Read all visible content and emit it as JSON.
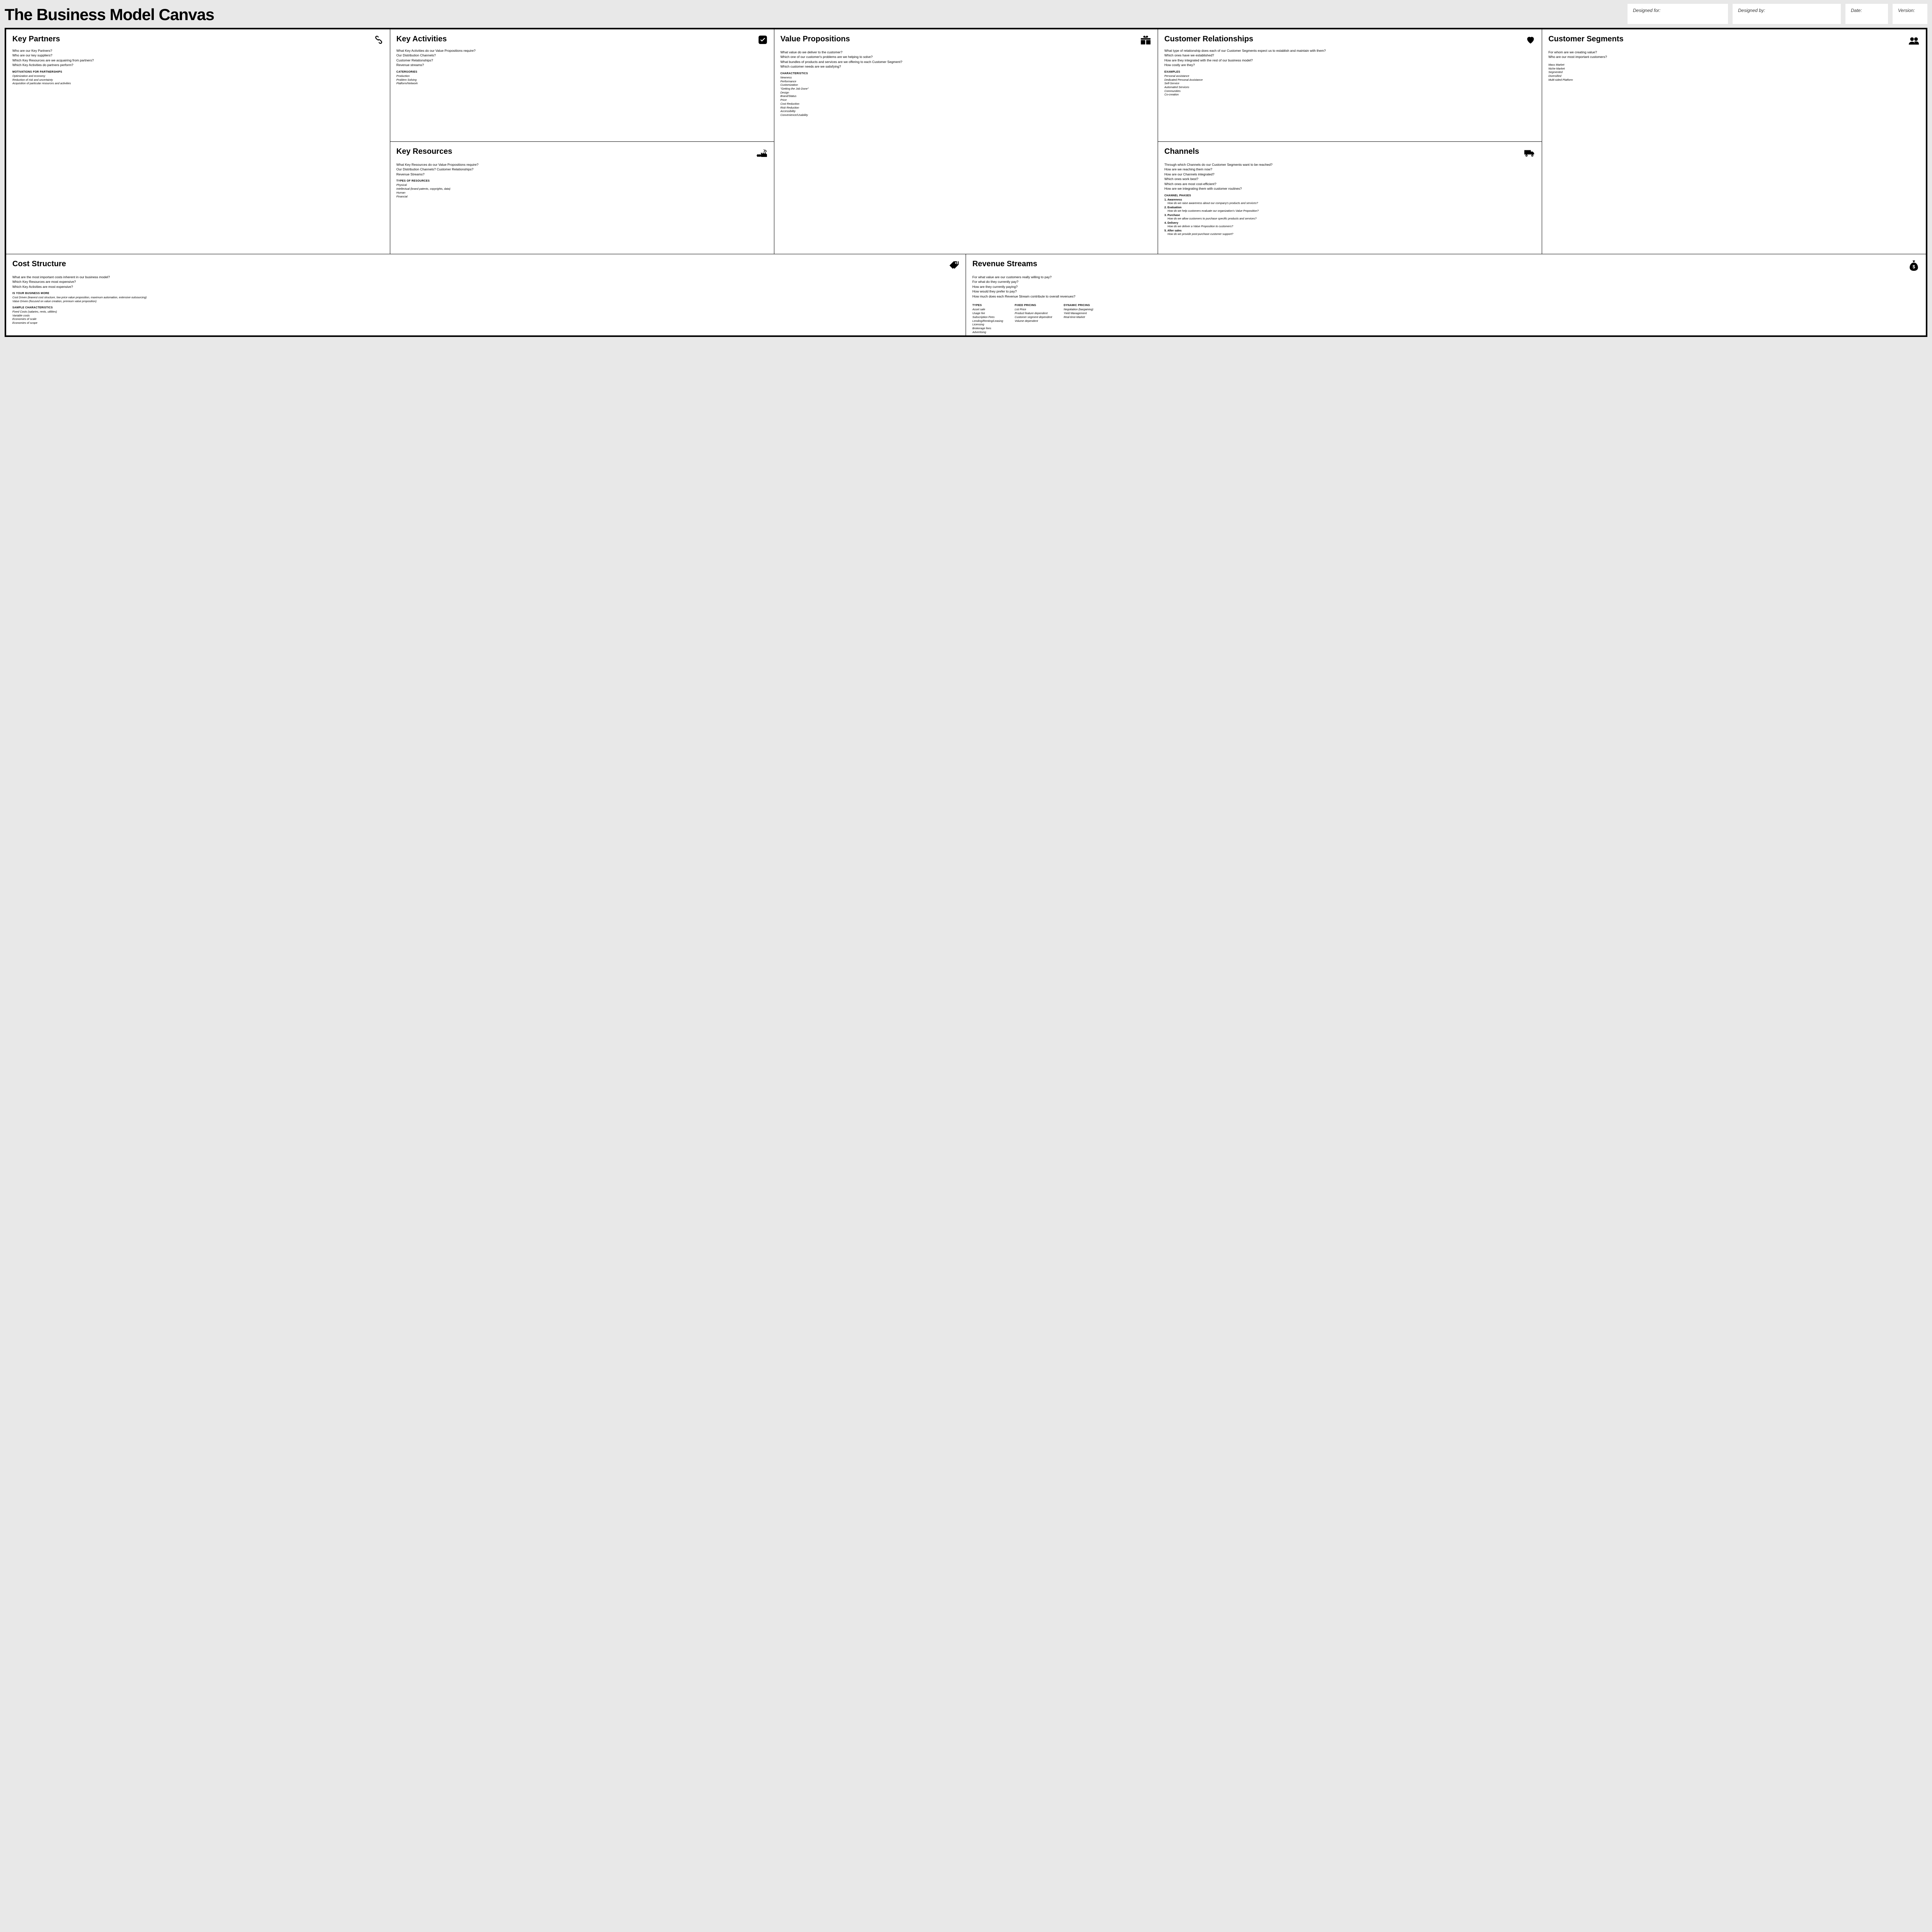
{
  "header": {
    "title": "The Business Model Canvas",
    "designed_for": "Designed for:",
    "designed_by": "Designed by:",
    "date": "Date:",
    "version": "Version:"
  },
  "kp": {
    "title": "Key Partners",
    "q": [
      "Who are our Key Partners?",
      "Who are our key suppliers?",
      "Which Key Resources are we acquairing from partners?",
      "Which Key Activities do partners perform?"
    ],
    "sub": "Motivations for Partnerships",
    "hints": [
      "Optimization and economy",
      "Reduction of risk and uncertainty",
      "Acquisition of particular resources and activities"
    ]
  },
  "ka": {
    "title": "Key Activities",
    "q": [
      "What Key Activities do our Value Propositions require?",
      "Our Distribution Channels?",
      "Customer Relationships?",
      "Revenue streams?"
    ],
    "sub": "Catergories",
    "hints": [
      "Production",
      "Problem Solving",
      "Platform/Network"
    ]
  },
  "kr": {
    "title": "Key Resources",
    "q": [
      "What Key Resources do our Value Propositions require?",
      "Our Distribution Channels? Customer Relationships?",
      "Revenue Streams?"
    ],
    "sub": "Types of Resources",
    "hints": [
      "Physical",
      "Intellectual (brand patents, copyrights, data)",
      "Human",
      "Financial"
    ]
  },
  "vp": {
    "title": "Value Propositions",
    "q": [
      "What value do we deliver to the customer?",
      "Which one of our customer's problems are we helping to solve?",
      "What bundles of products and services are we offering to each Customer Segment?",
      "Which customer needs are we satisfying?"
    ],
    "sub": "Characteristics",
    "hints": [
      "Newness",
      "Performance",
      "Customization",
      "\"Getting the Job Done\"",
      "Design",
      "Brand/Status",
      "Price",
      "Cost Reduction",
      "Risk Reduction",
      "Accessibility",
      "Convenience/Usability"
    ]
  },
  "cr": {
    "title": "Customer Relationships",
    "q": [
      "What type of relationship does each of our Customer Segments expect us to establish and maintain with them?",
      "Which ones have we established?",
      "How are they integrated with the rest of our business model?",
      "How costly are they?"
    ],
    "sub": "Examples",
    "hints": [
      "Personal assistance",
      "Dedicated Personal Assistance",
      "Self-Service",
      "Automated Services",
      "Communities",
      "Co-creation"
    ]
  },
  "ch": {
    "title": "Channels",
    "q": [
      "Through which Channels do our Customer Segments want to be reached?",
      "How are we reaching them now?",
      "How are our Channels integrated?",
      "Which ones work best?",
      "Which ones are most cost-efficient?",
      "How are we integrating them with customer routines?"
    ],
    "sub": "Channel Phases",
    "phases": [
      {
        "t": "1. Awareness",
        "d": "How do we raise awareness about our company's products and services?"
      },
      {
        "t": "2. Evaluation",
        "d": "How do we help customers evaluate our organization's Value Proposition?"
      },
      {
        "t": "3. Purchase",
        "d": "How do we allow customers to purchase specific products and services?"
      },
      {
        "t": "4. Delivery",
        "d": "How do we deliver a Value Proposition to customers?"
      },
      {
        "t": "5. After sales",
        "d": "How do we provide post-purchase customer support?"
      }
    ]
  },
  "cs": {
    "title": "Customer Segments",
    "q": [
      "For whom are we creating value?",
      "Who are our most important customers?"
    ],
    "hints": [
      "Mass Market",
      "Niche Market",
      "Segmented",
      "Diversified",
      "Multi-sided Platform"
    ]
  },
  "cost": {
    "title": "Cost Structure",
    "q": [
      "What are the most important costs inherent in our business model?",
      "Which Key Resources are most expensive?",
      "Which Key Activities are most expensive?"
    ],
    "sub1": "Is Your Business More",
    "hints1": [
      "Cost Driven (leanest cost structure, low price value proposition, maximum automation, extensive outsourcing)",
      "Value Driven (focused on value creation, premium value proposition)"
    ],
    "sub2": "Sample Characteristics",
    "hints2": [
      "Fixed Costs (salaries, rents, utilities)",
      "Variable costs",
      "Economies of scale",
      "Economies of scope"
    ]
  },
  "rev": {
    "title": "Revenue Streams",
    "q": [
      "For what value are our customers really willing to pay?",
      "For what do they currently pay?",
      "How are they currently paying?",
      "How would they prefer to pay?",
      "How much does each Revenue Stream contribute to overall revenues?"
    ],
    "c1t": "Types",
    "c1": [
      "Asset sale",
      "Usage fee",
      "Subscription Fees",
      "Lending/Renting/Leasing",
      "Licensing",
      "Brokerage fees",
      "Advertising"
    ],
    "c2t": "Fixed Pricing",
    "c2": [
      "List Price",
      "Product feature dependent",
      "Customer segment dependent",
      "Volume dependent"
    ],
    "c3t": "Dynamic Pricing",
    "c3": [
      "Negotiation (bargaining)",
      "Yield Management",
      "Real-time-Market"
    ]
  }
}
